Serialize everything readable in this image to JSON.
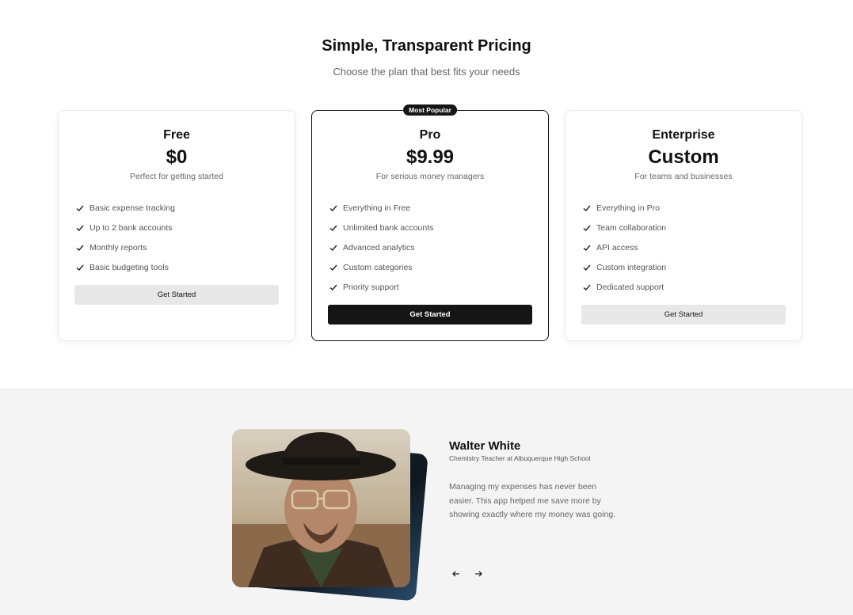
{
  "pricing": {
    "title": "Simple, Transparent Pricing",
    "subtitle": "Choose the plan that best fits your needs",
    "plans": [
      {
        "name": "Free",
        "price": "$0",
        "description": "Perfect for getting started",
        "features": [
          "Basic expense tracking",
          "Up to 2 bank accounts",
          "Monthly reports",
          "Basic budgeting tools"
        ],
        "button": "Get Started"
      },
      {
        "name": "Pro",
        "price": "$9.99",
        "description": "For serious money managers",
        "badge": "Most Popular",
        "features": [
          "Everything in Free",
          "Unlimited bank accounts",
          "Advanced analytics",
          "Custom categories",
          "Priority support"
        ],
        "button": "Get Started"
      },
      {
        "name": "Enterprise",
        "price": "Custom",
        "description": "For teams and businesses",
        "features": [
          "Everything in Pro",
          "Team collaboration",
          "API access",
          "Custom integration",
          "Dedicated support"
        ],
        "button": "Get Started"
      }
    ]
  },
  "testimonial": {
    "name": "Walter White",
    "role": "Chemistry Teacher at Albuquerque High School",
    "quote": "Managing my expenses has never been easier. This app helped me save more by showing exactly where my money was going.",
    "prev_icon": "arrow-left-icon",
    "next_icon": "arrow-right-icon"
  },
  "colors": {
    "accent": "#151515",
    "secondary_button": "#e8e8e8",
    "testimonial_bg": "#f4f4f4"
  }
}
